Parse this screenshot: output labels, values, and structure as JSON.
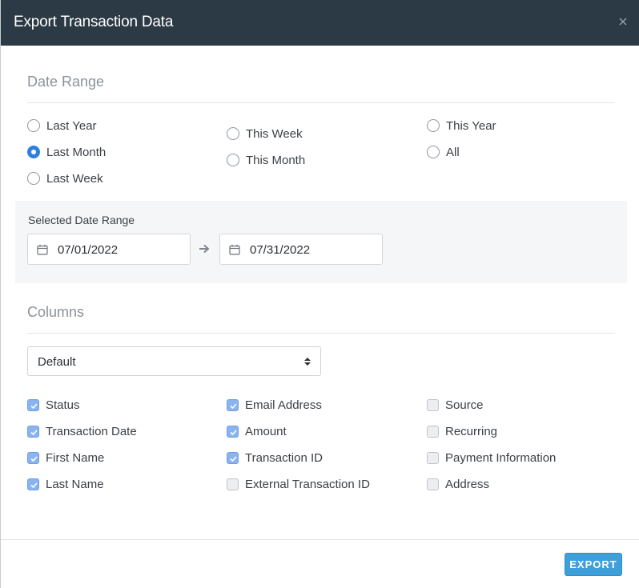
{
  "dialog": {
    "title": "Export Transaction Data",
    "close_icon": "close-icon"
  },
  "date_range": {
    "section_title": "Date Range",
    "options": [
      {
        "label": "Last Year",
        "checked": false
      },
      {
        "label": "Last Month",
        "checked": true
      },
      {
        "label": "Last Week",
        "checked": false
      },
      {
        "label": "This Week",
        "checked": false
      },
      {
        "label": "This Month",
        "checked": false
      },
      {
        "label": "This Year",
        "checked": false
      },
      {
        "label": "All",
        "checked": false
      }
    ],
    "selected_label": "Selected Date Range",
    "start_date": "07/01/2022",
    "end_date": "07/31/2022"
  },
  "columns": {
    "section_title": "Columns",
    "preset_selected": "Default",
    "items": [
      {
        "label": "Status",
        "checked": true
      },
      {
        "label": "Transaction Date",
        "checked": true
      },
      {
        "label": "First Name",
        "checked": true
      },
      {
        "label": "Last Name",
        "checked": true
      },
      {
        "label": "Email Address",
        "checked": true
      },
      {
        "label": "Amount",
        "checked": true
      },
      {
        "label": "Transaction ID",
        "checked": true
      },
      {
        "label": "External Transaction ID",
        "checked": false
      },
      {
        "label": "Source",
        "checked": false
      },
      {
        "label": "Recurring",
        "checked": false
      },
      {
        "label": "Payment Information",
        "checked": false
      },
      {
        "label": "Address",
        "checked": false
      }
    ]
  },
  "footer": {
    "export_label": "EXPORT"
  },
  "colors": {
    "header_bg": "#2c3a45",
    "accent_blue": "#2f7fe3",
    "checkbox_checked": "#8bb3ef",
    "export_button": "#3f9fd9"
  }
}
